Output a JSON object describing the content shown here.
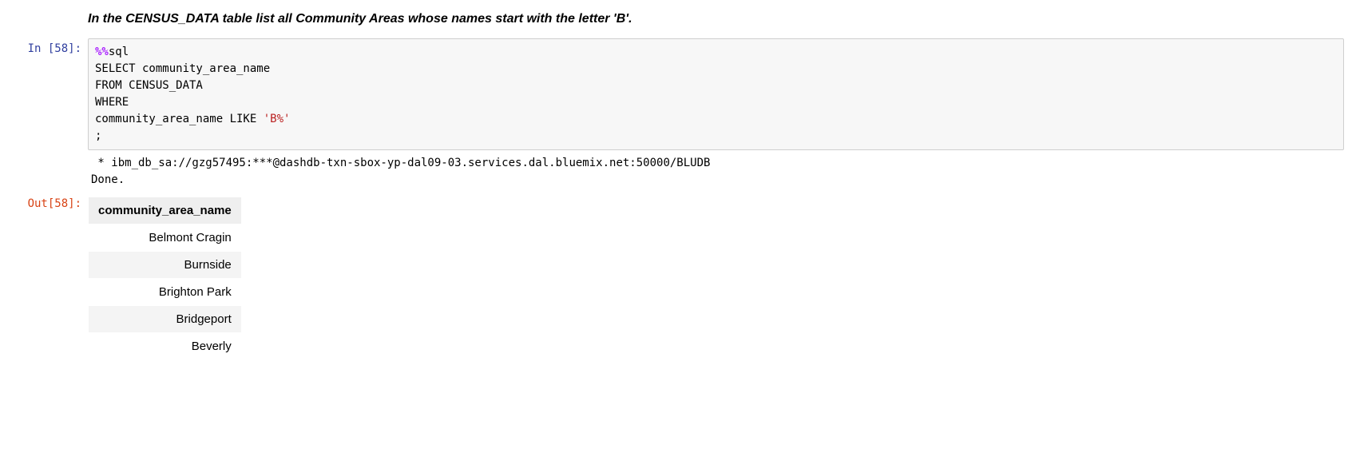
{
  "markdown": {
    "heading": "In the CENSUS_DATA table list all Community Areas whose names start with the letter 'B'."
  },
  "prompts": {
    "in_label": "In [58]:",
    "out_label": "Out[58]:"
  },
  "code": {
    "magic": "%%",
    "magic_cmd": "sql",
    "line1": "SELECT community_area_name",
    "line2": "FROM CENSUS_DATA",
    "line3": "WHERE",
    "line4a": "community_area_name LIKE ",
    "line4b": "'B%'",
    "line5": ";"
  },
  "stdout": {
    "line1": " * ibm_db_sa://gzg57495:***@dashdb-txn-sbox-yp-dal09-03.services.dal.bluemix.net:50000/BLUDB",
    "line2": "Done."
  },
  "table": {
    "header": "community_area_name",
    "rows": [
      "Belmont Cragin",
      "Burnside",
      "Brighton Park",
      "Bridgeport",
      "Beverly"
    ]
  }
}
